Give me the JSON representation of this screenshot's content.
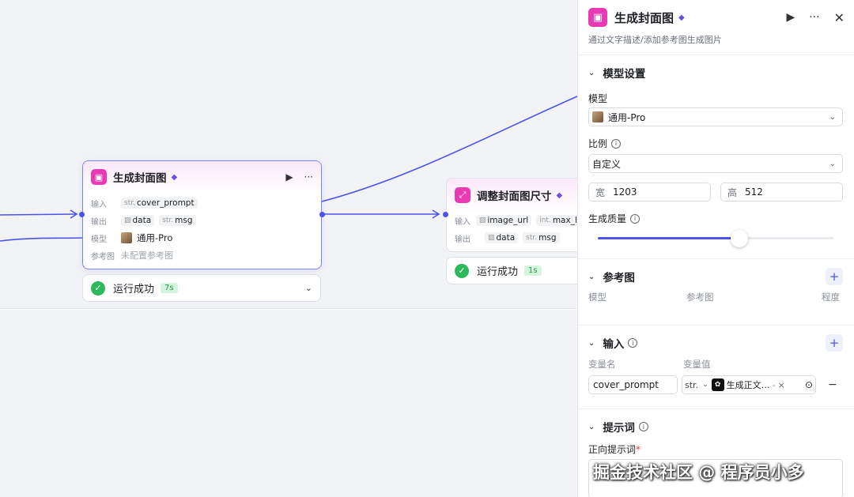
{
  "canvas": {
    "node1": {
      "title": "生成封面图",
      "input_label": "输入",
      "input_type": "str.",
      "input_name": "cover_prompt",
      "output_label": "输出",
      "output_data": "data",
      "output_msg_type": "str.",
      "output_msg": "msg",
      "model_label": "模型",
      "model_value": "通用-Pro",
      "ref_label": "参考图",
      "ref_value": "未配置参考图",
      "status": "运行成功",
      "duration": "7s"
    },
    "node2": {
      "title": "调整封面图尺寸",
      "input_label": "输入",
      "input_name": "image_url",
      "input2_type": "int.",
      "input2_name": "max_len",
      "output_label": "输出",
      "output_data": "data",
      "output_msg_type": "str.",
      "output_msg": "msg",
      "status": "运行成功",
      "duration": "1s"
    }
  },
  "panel": {
    "title": "生成封面图",
    "description": "通过文字描述/添加参考图生成图片",
    "model_section": {
      "header": "模型设置",
      "model_label": "模型",
      "model_value": "通用-Pro",
      "ratio_label": "比例",
      "ratio_value": "自定义",
      "width_label": "宽",
      "width_value": "1203",
      "height_label": "高",
      "height_value": "512",
      "quality_label": "生成质量",
      "quality_fraction": 0.6
    },
    "ref_section": {
      "header": "参考图",
      "col_model": "模型",
      "col_ref": "参考图",
      "col_degree": "程度"
    },
    "input_section": {
      "header": "输入",
      "col_name": "变量名",
      "col_value": "变量值",
      "var_name": "cover_prompt",
      "var_type": "str.",
      "var_ref": "生成正文…",
      "var_ref_sep": "-"
    },
    "prompt_section": {
      "header": "提示词",
      "positive_label": "正向提示词",
      "required_mark": "*"
    }
  },
  "watermark": "掘金技术社区 @ 程序员小多",
  "colors": {
    "accent": "#4d53e8",
    "node_icon": "#e93ab3",
    "success": "#2eb85c"
  }
}
